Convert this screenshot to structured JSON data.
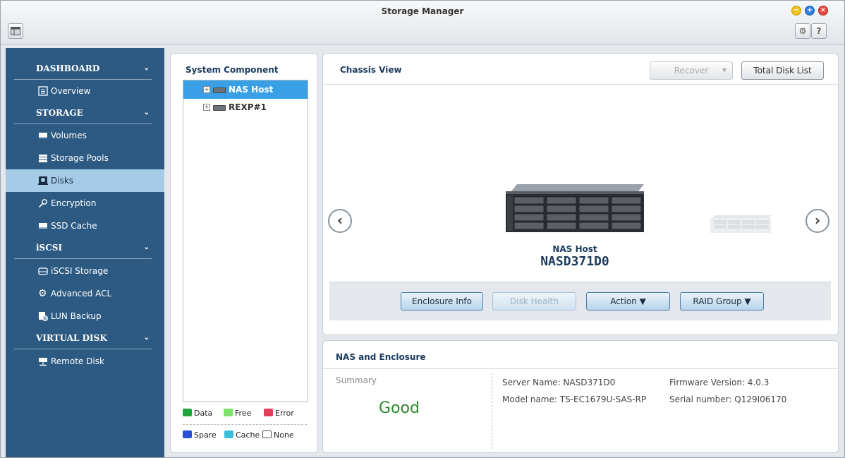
{
  "window": {
    "title": "Storage Manager"
  },
  "sidebar": {
    "sections": [
      {
        "label": "DASHBOARD",
        "items": [
          {
            "label": "Overview",
            "icon": "overview-icon"
          }
        ]
      },
      {
        "label": "STORAGE",
        "items": [
          {
            "label": "Volumes",
            "icon": "volume-icon"
          },
          {
            "label": "Storage Pools",
            "icon": "storage-pool-icon"
          },
          {
            "label": "Disks",
            "icon": "disk-icon",
            "active": true
          },
          {
            "label": "Encryption",
            "icon": "key-icon"
          },
          {
            "label": "SSD Cache",
            "icon": "ssd-icon"
          }
        ]
      },
      {
        "label": "iSCSI",
        "items": [
          {
            "label": "iSCSI Storage",
            "icon": "iscsi-storage-icon"
          },
          {
            "label": "Advanced ACL",
            "icon": "gear-icon"
          },
          {
            "label": "LUN Backup",
            "icon": "lun-backup-icon"
          }
        ]
      },
      {
        "label": "VIRTUAL DISK",
        "items": [
          {
            "label": "Remote Disk",
            "icon": "remote-disk-icon"
          }
        ]
      }
    ],
    "chevron": "v"
  },
  "system_component": {
    "title": "System Component",
    "tree": [
      {
        "label": "NAS Host",
        "selected": true
      },
      {
        "label": "REXP#1",
        "selected": false
      }
    ],
    "legend": [
      {
        "label": "Data",
        "color": "#1fa53a"
      },
      {
        "label": "Free",
        "color": "#7ee36a"
      },
      {
        "label": "Error",
        "color": "#e0405a"
      },
      {
        "label": "Spare",
        "color": "#2b4fd6"
      },
      {
        "label": "Cache",
        "color": "#39c0d8"
      },
      {
        "label": "None",
        "color": "#ffffff"
      }
    ]
  },
  "chassis": {
    "title": "Chassis View",
    "recover_label": "Recover",
    "total_disk_list_label": "Total Disk List",
    "device_label": "NAS Host",
    "device_name": "NASD371D0",
    "buttons": {
      "enclosure_info": "Enclosure Info",
      "disk_health": "Disk Health",
      "action": "Action ▼",
      "raid_group": "RAID Group ▼"
    }
  },
  "nas_enclosure": {
    "title": "NAS and Enclosure",
    "summary_label": "Summary",
    "summary_value": "Good",
    "server_name": "Server Name: NASD371D0",
    "model_name": "Model name: TS-EC1679U-SAS-RP",
    "firmware": "Firmware Version: 4.0.3",
    "serial": "Serial number: Q129I06170",
    "good_color": "#2b8a2b"
  }
}
